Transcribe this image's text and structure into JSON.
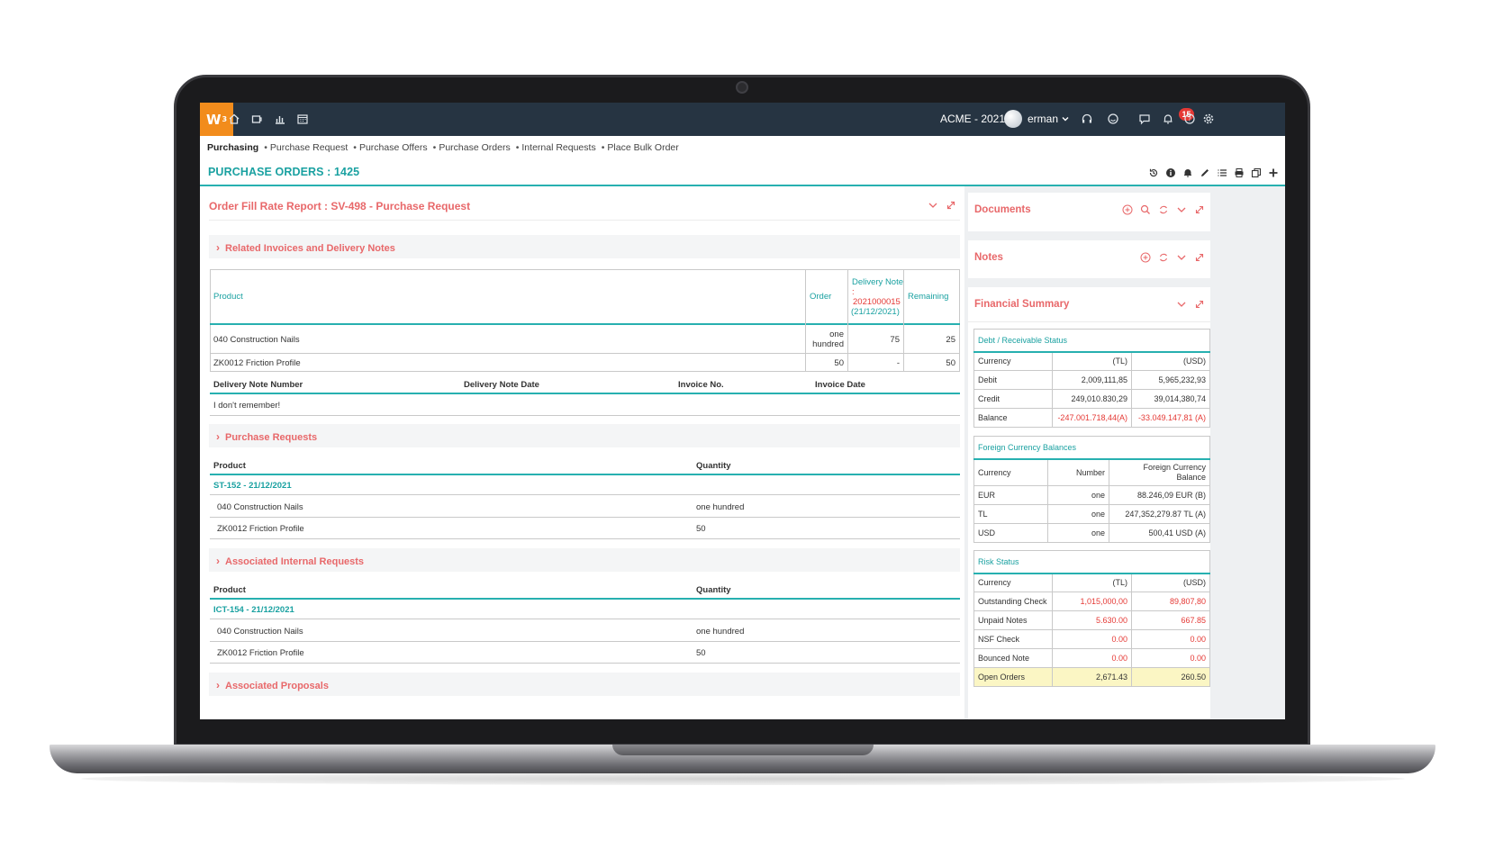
{
  "topbar": {
    "logo": "W",
    "logo_sup": "3",
    "company": "ACME - 2021",
    "user": "erman",
    "message_badge": "15"
  },
  "breadcrumb": {
    "root": "Purchasing",
    "items": [
      "Purchase Request",
      "Purchase Offers",
      "Purchase Orders",
      "Internal Requests",
      "Place Bulk Order"
    ]
  },
  "page_title": "PURCHASE ORDERS : 1425",
  "report": {
    "title": "Order Fill Rate Report : SV-498 - Purchase Request",
    "related_section": "Related Invoices and Delivery Notes",
    "table_headers": {
      "product": "Product",
      "order": "Order",
      "delivery_note_l1": "Delivery Note",
      "delivery_note_l2": ":",
      "delivery_note_no": "2021000015",
      "delivery_note_date": "(21/12/2021)",
      "remaining": "Remaining"
    },
    "rows": [
      {
        "product": "040 Construction Nails",
        "order_l1": "one",
        "order_l2": "hundred",
        "delivery": "75",
        "remaining": "25"
      },
      {
        "product": "ZK0012 Friction Profile",
        "order_l1": "50",
        "order_l2": "",
        "delivery": "-",
        "remaining": "50"
      }
    ],
    "dn_headers": {
      "number": "Delivery Note Number",
      "date": "Delivery Note Date",
      "invoice_no": "Invoice No.",
      "invoice_date": "Invoice Date"
    },
    "dn_note": "I don't remember!",
    "purchase_requests": {
      "title": "Purchase Requests",
      "col_product": "Product",
      "col_quantity": "Quantity",
      "group": "ST-152 - 21/12/2021",
      "rows": [
        {
          "product": "040 Construction Nails",
          "quantity": "one hundred"
        },
        {
          "product": "ZK0012 Friction Profile",
          "quantity": "50"
        }
      ]
    },
    "internal_requests": {
      "title": "Associated Internal Requests",
      "col_product": "Product",
      "col_quantity": "Quantity",
      "group": "ICT-154 - 21/12/2021",
      "rows": [
        {
          "product": "040 Construction Nails",
          "quantity": "one hundred"
        },
        {
          "product": "ZK0012 Friction Profile",
          "quantity": "50"
        }
      ]
    },
    "proposals_title": "Associated Proposals"
  },
  "side": {
    "documents": "Documents",
    "notes": "Notes",
    "financial_summary": "Financial Summary",
    "debt": {
      "title": "Debt / Receivable Status",
      "headers": [
        "Currency",
        "(TL)",
        "(USD)"
      ],
      "rows": [
        [
          "Debit",
          "2,009,111,85",
          "5,965,232,93"
        ],
        [
          "Credit",
          "249,010.830,29",
          "39,014,380,74"
        ],
        [
          "Balance",
          "-247.001.718,44(A)",
          "-33.049.147,81 (A)"
        ]
      ]
    },
    "fx": {
      "title": "Foreign Currency Balances",
      "headers": [
        "Currency",
        "Number",
        "Foreign Currency",
        "Balance"
      ],
      "rows": [
        [
          "EUR",
          "one",
          "88.246,09 EUR (B)"
        ],
        [
          "TL",
          "one",
          "247,352,279.87 TL (A)"
        ],
        [
          "USD",
          "one",
          "500,41 USD (A)"
        ]
      ]
    },
    "risk": {
      "title": "Risk Status",
      "headers": [
        "Currency",
        "(TL)",
        "(USD)"
      ],
      "rows": [
        [
          "Outstanding Check",
          "1,015,000,00",
          "89,807,80"
        ],
        [
          "Unpaid Notes",
          "5.630.00",
          "667.85"
        ],
        [
          "NSF Check",
          "0.00",
          "0.00"
        ],
        [
          "Bounced Note",
          "0.00",
          "0.00"
        ],
        [
          "Open Orders",
          "2,671.43",
          "260.50"
        ]
      ]
    }
  },
  "colors": {
    "accent_teal": "#27b0b0",
    "accent_red": "#e8686a",
    "logo_orange": "#f28c1c",
    "topbar": "#263442"
  }
}
